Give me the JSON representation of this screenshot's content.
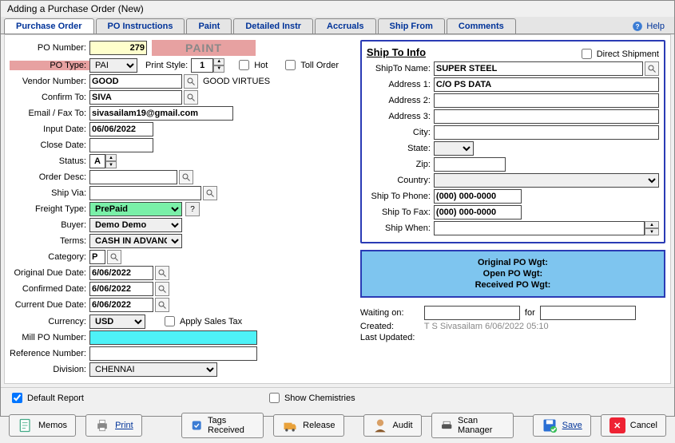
{
  "window_title": "Adding a Purchase Order  (New)",
  "tabs": {
    "purchase_order": "Purchase Order",
    "po_instructions": "PO Instructions",
    "paint": "Paint",
    "detailed_instr": "Detailed Instr",
    "accruals": "Accruals",
    "ship_from": "Ship From",
    "comments": "Comments"
  },
  "help": "Help",
  "paint_banner": "PAINT",
  "labels": {
    "po_number": "PO Number:",
    "po_type": "PO Type:",
    "print_style": "Print Style:",
    "hot": "Hot",
    "toll_order": "Toll Order",
    "vendor_number": "Vendor Number:",
    "confirm_to": "Confirm To:",
    "email_fax_to": "Email / Fax To:",
    "input_date": "Input Date:",
    "close_date": "Close Date:",
    "status": "Status:",
    "order_desc": "Order Desc:",
    "ship_via": "Ship Via:",
    "freight_type": "Freight Type:",
    "buyer": "Buyer:",
    "terms": "Terms:",
    "category": "Category:",
    "orig_due": "Original Due Date:",
    "confirmed": "Confirmed Date:",
    "current_due": "Current Due Date:",
    "currency": "Currency:",
    "apply_tax": "Apply Sales Tax",
    "mill_po": "Mill PO Number:",
    "ref_no": "Reference Number:",
    "division": "Division:"
  },
  "left": {
    "po_number": "279",
    "po_type": "PAI",
    "print_style": "1",
    "vendor_number": "GOOD",
    "vendor_name": "GOOD VIRTUES",
    "confirm_to": "SIVA",
    "email_fax_to": "sivasailam19@gmail.com",
    "input_date": "06/06/2022",
    "close_date": "",
    "status": "A",
    "order_desc": "",
    "ship_via": "",
    "freight_type": "PrePaid",
    "buyer": "Demo Demo",
    "terms": "CASH IN ADVANCE",
    "category": "P",
    "orig_due": "6/06/2022",
    "confirmed": "6/06/2022",
    "current_due": "6/06/2022",
    "currency": "USD",
    "mill_po": "",
    "ref_no": "",
    "division": "CHENNAI"
  },
  "shipto": {
    "heading": "Ship To Info",
    "direct_shipment": "Direct Shipment",
    "labels": {
      "name": "ShipTo Name:",
      "addr1": "Address 1:",
      "addr2": "Address 2:",
      "addr3": "Address 3:",
      "city": "City:",
      "state": "State:",
      "zip": "Zip:",
      "country": "Country:",
      "phone": "Ship To Phone:",
      "fax": "Ship To Fax:",
      "when": "Ship When:"
    },
    "name": "SUPER STEEL",
    "addr1": "C/O PS DATA",
    "addr2": "",
    "addr3": "",
    "city": "",
    "state": "",
    "zip": "",
    "country": "",
    "phone": "(000) 000-0000",
    "fax": "(000) 000-0000",
    "when": ""
  },
  "wgt": {
    "orig": "Original PO Wgt:",
    "open": "Open PO Wgt:",
    "recv": "Received PO Wgt:"
  },
  "meta": {
    "waiting_label": "Waiting on:",
    "for": "for",
    "created_label": "Created:",
    "created_val": "T S Sivasailam 6/06/2022 05:10",
    "updated_label": "Last Updated:"
  },
  "footer": {
    "default_report": "Default Report",
    "show_chem": "Show Chemistries"
  },
  "actions": {
    "memos": "Memos",
    "print": "Print",
    "tags_received": "Tags Received",
    "release": "Release",
    "audit": "Audit",
    "scan_manager": "Scan Manager",
    "save": "Save",
    "cancel": "Cancel"
  }
}
